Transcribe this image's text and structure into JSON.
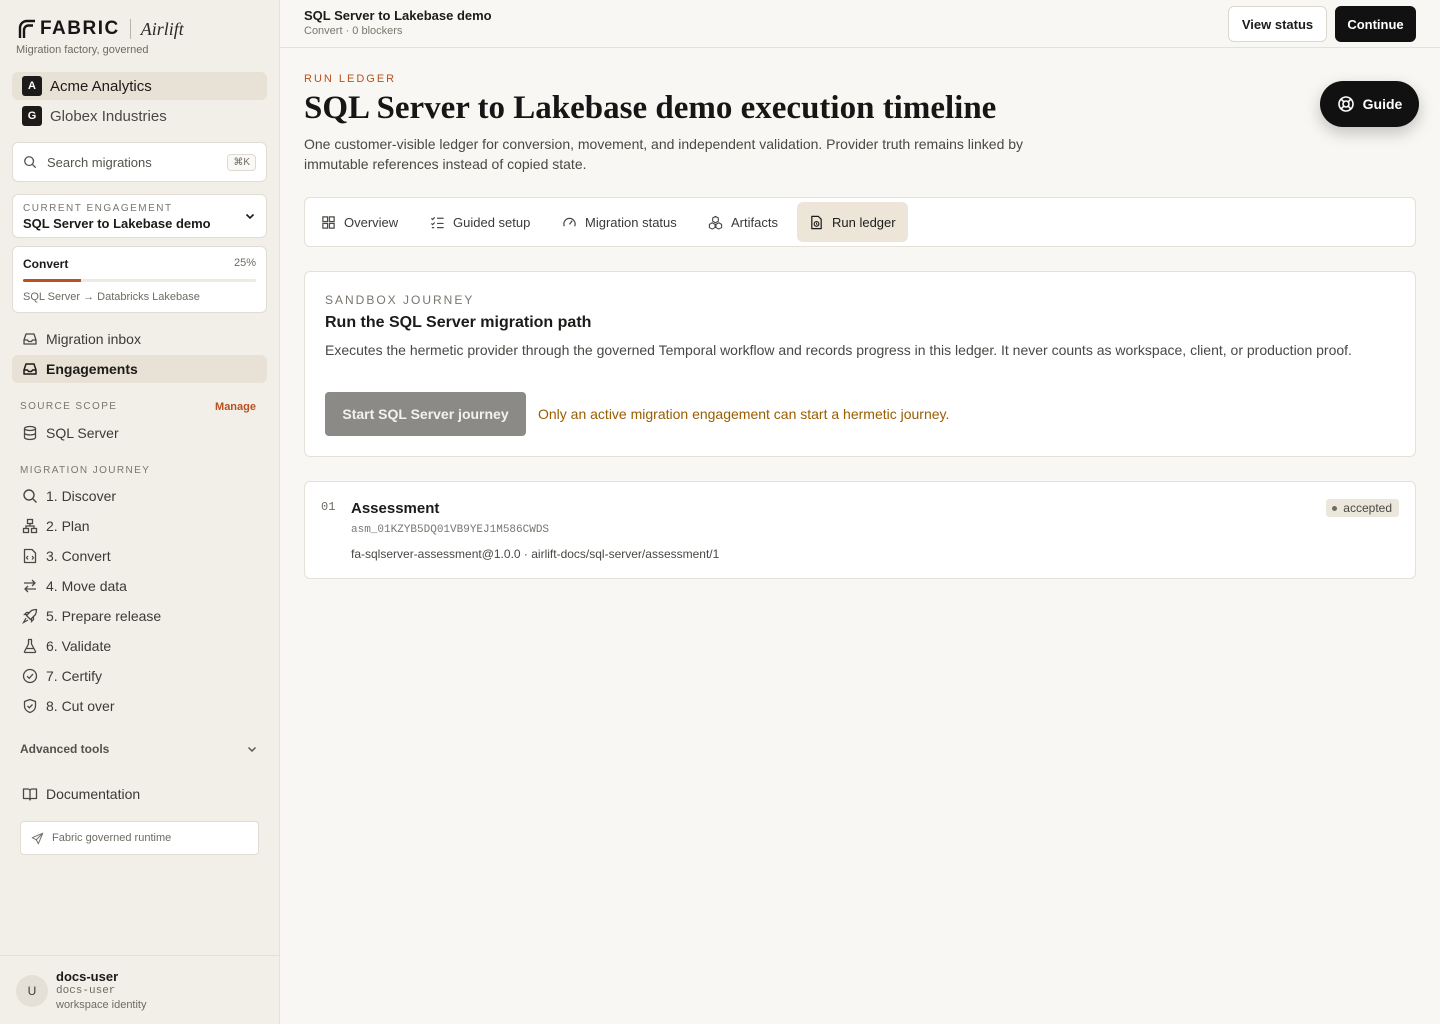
{
  "brand": {
    "name": "FABRIC",
    "product": "Airlift",
    "tagline": "Migration factory, governed"
  },
  "orgs": [
    {
      "badge": "A",
      "name": "Acme Analytics",
      "active": true
    },
    {
      "badge": "G",
      "name": "Globex Industries",
      "active": false
    }
  ],
  "search": {
    "placeholder": "Search migrations",
    "shortcut": "⌘K"
  },
  "engagement": {
    "label": "CURRENT ENGAGEMENT",
    "value": "SQL Server to Lakebase demo"
  },
  "progress": {
    "stage": "Convert",
    "percent_label": "25%",
    "percent": 25,
    "route": "SQL Server → Databricks Lakebase"
  },
  "primary_nav": [
    {
      "label": "Migration inbox",
      "icon": "inbox-icon",
      "active": false
    },
    {
      "label": "Engagements",
      "icon": "briefcase-inbox-icon",
      "active": true
    }
  ],
  "source_scope": {
    "heading": "SOURCE SCOPE",
    "manage": "Manage",
    "items": [
      {
        "label": "SQL Server",
        "icon": "database-icon"
      }
    ]
  },
  "journey": {
    "heading": "MIGRATION JOURNEY",
    "items": [
      {
        "label": "1. Discover",
        "icon": "search-icon"
      },
      {
        "label": "2. Plan",
        "icon": "network-icon"
      },
      {
        "label": "3. Convert",
        "icon": "code-file-icon"
      },
      {
        "label": "4. Move data",
        "icon": "arrows-exchange-icon"
      },
      {
        "label": "5. Prepare release",
        "icon": "rocket-icon"
      },
      {
        "label": "6. Validate",
        "icon": "flask-icon"
      },
      {
        "label": "7. Certify",
        "icon": "check-circle-icon"
      },
      {
        "label": "8. Cut over",
        "icon": "shield-check-icon"
      }
    ]
  },
  "advanced_tools": {
    "label": "Advanced tools"
  },
  "documentation": {
    "label": "Documentation"
  },
  "runtime": {
    "label": "Fabric governed runtime"
  },
  "user": {
    "initial": "U",
    "name": "docs-user",
    "handle": "docs-user",
    "role": "workspace identity"
  },
  "topbar": {
    "title": "SQL Server to Lakebase demo",
    "subtitle": "Convert · 0 blockers",
    "view_status": "View status",
    "continue": "Continue"
  },
  "header": {
    "eyebrow": "RUN LEDGER",
    "title": "SQL Server to Lakebase demo execution timeline",
    "description": "One customer-visible ledger for conversion, movement, and independent validation. Provider truth remains linked by immutable references instead of copied state.",
    "guide": "Guide"
  },
  "tabs": [
    {
      "label": "Overview",
      "icon": "grid-icon",
      "active": false
    },
    {
      "label": "Guided setup",
      "icon": "checklist-icon",
      "active": false
    },
    {
      "label": "Migration status",
      "icon": "gauge-icon",
      "active": false
    },
    {
      "label": "Artifacts",
      "icon": "boxes-icon",
      "active": false
    },
    {
      "label": "Run ledger",
      "icon": "ledger-icon",
      "active": true
    }
  ],
  "sandbox": {
    "eyebrow": "SANDBOX JOURNEY",
    "title": "Run the SQL Server migration path",
    "description": "Executes the hermetic provider through the governed Temporal workflow and records progress in this ledger. It never counts as workspace, client, or production proof.",
    "button": "Start SQL Server journey",
    "warning": "Only an active migration engagement can start a hermetic journey."
  },
  "ledger": [
    {
      "number": "01",
      "title": "Assessment",
      "id": "asm_01KZYB5DQ01VB9YEJ1M586CWDS",
      "ref": "fa-sqlserver-assessment@1.0.0 · airlift-docs/sql-server/assessment/1",
      "status": "accepted"
    }
  ]
}
